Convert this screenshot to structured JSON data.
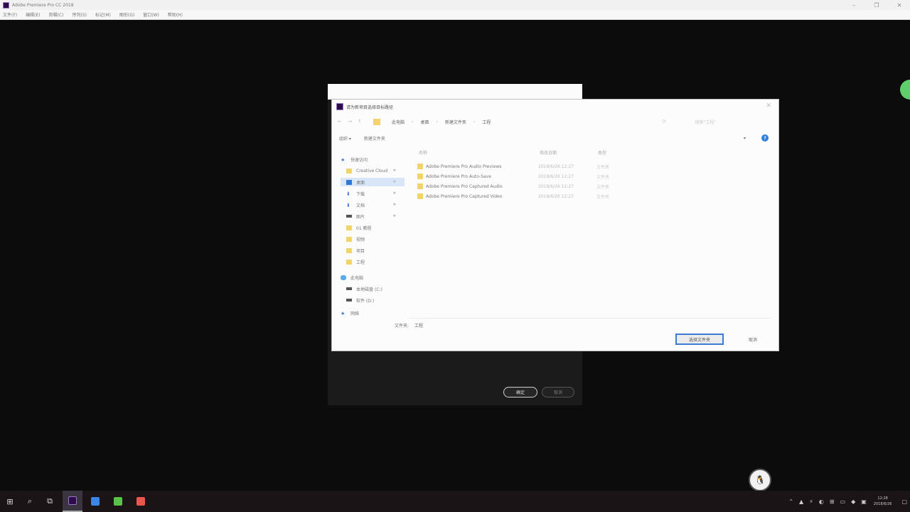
{
  "window": {
    "title": "Adobe Premiere Pro CC 2018",
    "min": "–",
    "max": "❐",
    "close": "✕"
  },
  "menubar": [
    "文件(F)",
    "编辑(E)",
    "剪辑(C)",
    "序列(S)",
    "标记(M)",
    "图形(G)",
    "窗口(W)",
    "帮助(H)"
  ],
  "background_dialog": {
    "ok_label": "确定",
    "cancel_label": "取消"
  },
  "dialog": {
    "title": "请为新项目选择目标路径",
    "nav": {
      "back": "←",
      "forward": "→",
      "up": "↑",
      "breadcrumbs": [
        "此电脑",
        "桌面",
        "新建文件夹",
        "工程"
      ],
      "crumb_sep": "›",
      "refresh": "⟳",
      "search_placeholder": "搜索\"工程\""
    },
    "toolbar": {
      "organize": "组织 ▾",
      "new_folder": "新建文件夹",
      "view": "▾",
      "help": "?"
    },
    "sidebar": [
      {
        "label": "快速访问",
        "icon": "star-icon",
        "type": "star"
      },
      {
        "label": "Creative Cloud",
        "icon": "folder-icon",
        "type": "yellow",
        "pin": "✱"
      },
      {
        "label": "桌面",
        "icon": "desktop-icon",
        "type": "blue",
        "pin": "✱",
        "selected": true
      },
      {
        "label": "下载",
        "icon": "download-icon",
        "type": "down",
        "pin": "✱"
      },
      {
        "label": "文档",
        "icon": "document-icon",
        "type": "down",
        "pin": "✱"
      },
      {
        "label": "图片",
        "icon": "picture-icon",
        "type": "drive",
        "pin": "✱"
      },
      {
        "label": "01 教程",
        "icon": "folder-icon",
        "type": "yellow"
      },
      {
        "label": "视频",
        "icon": "folder-icon",
        "type": "yellow"
      },
      {
        "label": "项目",
        "icon": "folder-icon",
        "type": "yellow"
      },
      {
        "label": "工程",
        "icon": "folder-icon",
        "type": "yellow"
      },
      {
        "label": "此电脑",
        "icon": "computer-icon",
        "type": "cloud"
      },
      {
        "label": "本地磁盘 (C:)",
        "icon": "drive-icon",
        "type": "drive"
      },
      {
        "label": "软件 (D:)",
        "icon": "drive-icon",
        "type": "drive"
      },
      {
        "label": "网络",
        "icon": "network-icon",
        "type": "star"
      }
    ],
    "columns": {
      "name": "名称",
      "date": "修改日期",
      "type": "类型"
    },
    "files": [
      {
        "name": "Adobe Premiere Pro Audio Previews",
        "date": "2018/6/26 12:27",
        "type": "文件夹"
      },
      {
        "name": "Adobe Premiere Pro Auto-Save",
        "date": "2018/6/26 12:27",
        "type": "文件夹"
      },
      {
        "name": "Adobe Premiere Pro Captured Audio",
        "date": "2018/6/26 12:27",
        "type": "文件夹"
      },
      {
        "name": "Adobe Premiere Pro Captured Video",
        "date": "2018/6/26 12:27",
        "type": "文件夹"
      }
    ],
    "folder_label": "文件夹:",
    "folder_value": "工程",
    "select_button": "选择文件夹",
    "cancel_button": "取消"
  },
  "taskbar": {
    "start": "⊞",
    "search": "⌕",
    "taskview": "⧉",
    "apps": [
      {
        "name": "premiere-app",
        "color": "#2d0a4a",
        "active": true
      },
      {
        "name": "app-blue",
        "color": "#3a86e8"
      },
      {
        "name": "app-green",
        "color": "#58c24a"
      },
      {
        "name": "app-red",
        "color": "#e9564a"
      }
    ],
    "tray": [
      "⌃",
      "▲",
      "⚡",
      "◐",
      "⊞",
      "▭",
      "◆",
      "▣"
    ],
    "time": "12:28",
    "date": "2018/6/26",
    "notify": "▢"
  }
}
